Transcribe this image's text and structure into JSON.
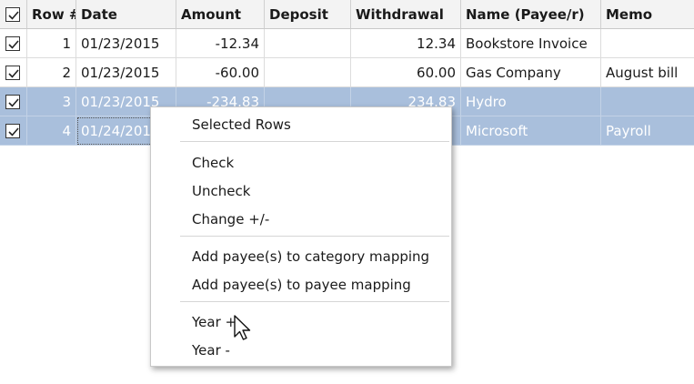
{
  "header": {
    "row_num": "Row #",
    "date": "Date",
    "amount": "Amount",
    "deposit": "Deposit",
    "withdrawal": "Withdrawal",
    "name": "Name (Payee/r)",
    "memo": "Memo"
  },
  "rows": [
    {
      "row": "1",
      "date": "01/23/2015",
      "amount": "-12.34",
      "deposit": "",
      "withdrawal": "12.34",
      "name": "Bookstore Invoice",
      "memo": "",
      "checked": true,
      "selected": false
    },
    {
      "row": "2",
      "date": "01/23/2015",
      "amount": "-60.00",
      "deposit": "",
      "withdrawal": "60.00",
      "name": "Gas Company",
      "memo": "August bill",
      "checked": true,
      "selected": false
    },
    {
      "row": "3",
      "date": "01/23/2015",
      "amount": "-234.83",
      "deposit": "",
      "withdrawal": "234.83",
      "name": "Hydro",
      "memo": "",
      "checked": true,
      "selected": true
    },
    {
      "row": "4",
      "date": "01/24/2015",
      "amount": "",
      "deposit": "",
      "withdrawal": "",
      "name": "Microsoft",
      "memo": "Payroll",
      "checked": true,
      "selected": true
    }
  ],
  "context_menu": {
    "title": "Selected Rows",
    "check": "Check",
    "uncheck": "Uncheck",
    "change_sign": "Change +/-",
    "add_category_mapping": "Add payee(s) to category mapping",
    "add_payee_mapping": "Add payee(s) to payee mapping",
    "year_plus": "Year +",
    "year_minus": "Year -"
  },
  "colors": {
    "selection": "#a9bfdc",
    "header_bg": "#f3f3f3"
  },
  "icons": {
    "checkbox": "checkbox-checked-icon",
    "cursor": "mouse-pointer-icon"
  }
}
